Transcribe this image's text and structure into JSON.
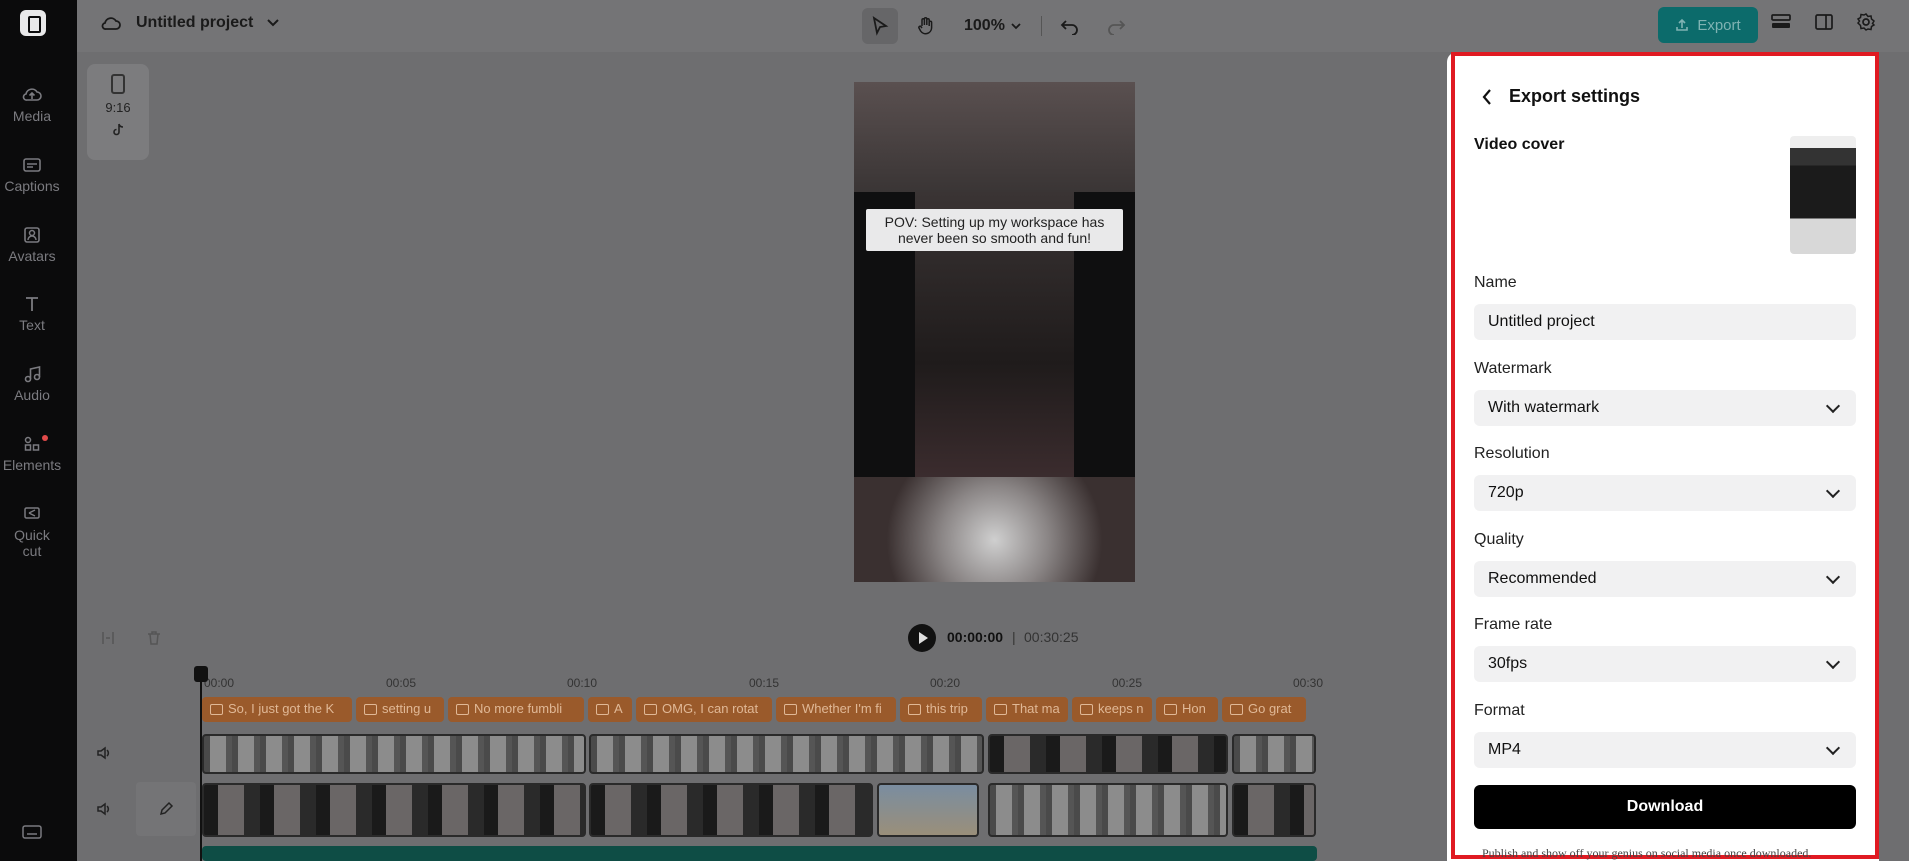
{
  "rail": {
    "items": [
      {
        "label": "Media",
        "icon": "cloud-upload-icon"
      },
      {
        "label": "Captions",
        "icon": "captions-icon"
      },
      {
        "label": "Avatars",
        "icon": "avatar-icon"
      },
      {
        "label": "Text",
        "icon": "text-icon"
      },
      {
        "label": "Audio",
        "icon": "music-note-icon"
      },
      {
        "label": "Elements",
        "icon": "elements-icon"
      },
      {
        "label": "Quick",
        "label2": "cut",
        "icon": "quick-cut-icon"
      }
    ]
  },
  "header": {
    "project_title": "Untitled project",
    "zoom": "100%",
    "export_label": "Export"
  },
  "ratio": {
    "label": "9:16"
  },
  "preview": {
    "caption_line1": "POV: Setting up my workspace has",
    "caption_line2": "never been so smooth and fun!"
  },
  "timeline": {
    "current_time": "00:00:00",
    "separator": "|",
    "total_time": "00:30:25",
    "ticks": [
      "00:00",
      "00:05",
      "00:10",
      "00:15",
      "00:20",
      "00:25",
      "00:30"
    ],
    "captions": [
      "So, I just got the K",
      "setting u",
      "No more fumbli",
      "A",
      "OMG, I can rotat",
      "Whether I'm fi",
      "this trip",
      "That ma",
      "keeps n",
      "Hon",
      "Go grat"
    ]
  },
  "export_panel": {
    "title": "Export settings",
    "video_cover_label": "Video cover",
    "name_label": "Name",
    "name_value": "Untitled project",
    "watermark_label": "Watermark",
    "watermark_value": "With watermark",
    "resolution_label": "Resolution",
    "resolution_value": "720p",
    "quality_label": "Quality",
    "quality_value": "Recommended",
    "framerate_label": "Frame rate",
    "framerate_value": "30fps",
    "format_label": "Format",
    "format_value": "MP4",
    "download_label": "Download",
    "hint": "Publish and show off your genius on social media once downloaded."
  },
  "colors": {
    "accent": "#0c6b6b",
    "highlight": "#e01a22",
    "caption_clip": "#9a5a2b"
  }
}
